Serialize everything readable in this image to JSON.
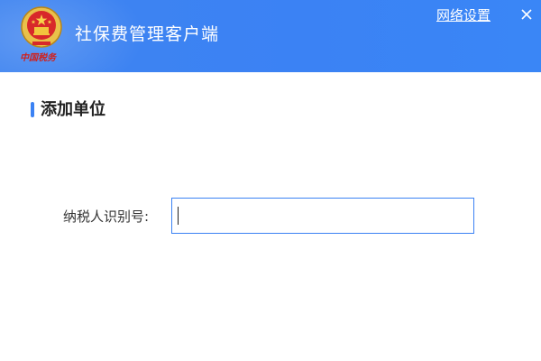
{
  "header": {
    "logo_caption": "中国税务",
    "app_title": "社保费管理客户端",
    "network_settings": "网络设置",
    "emblem_icon": "national-emblem-icon",
    "close_icon": "close-icon",
    "bg_color": "#3b82f4"
  },
  "section": {
    "title": "添加单位",
    "accent_color": "#3b82f4"
  },
  "form": {
    "taxpayer_id_label": "纳税人识别号:",
    "taxpayer_id_value": "",
    "taxpayer_id_placeholder": ""
  }
}
